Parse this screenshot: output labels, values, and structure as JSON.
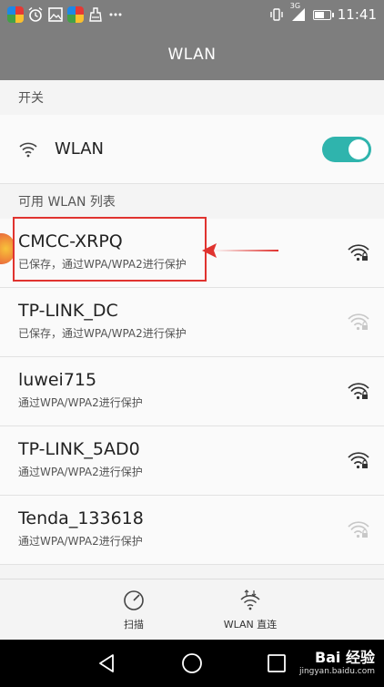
{
  "status_bar": {
    "time": "11:41",
    "network_type": "3G",
    "battery_percent": 70,
    "icons": [
      "browser-app-icon",
      "alarm-icon",
      "gallery-icon",
      "browser-app-icon",
      "cleaner-icon",
      "more-notifications-icon",
      "vibrate-icon",
      "signal-icon",
      "battery-icon"
    ]
  },
  "header": {
    "title": "WLAN"
  },
  "switch_section": {
    "header": "开关",
    "wlan_label": "WLAN",
    "wlan_enabled": true
  },
  "networks_section": {
    "header": "可用 WLAN 列表",
    "networks": [
      {
        "name": "CMCC-XRPQ",
        "status": "已保存，通过WPA/WPA2进行保护",
        "signal": "strong"
      },
      {
        "name": "TP-LINK_DC",
        "status": "已保存，通过WPA/WPA2进行保护",
        "signal": "weak"
      },
      {
        "name": "luwei715",
        "status": "通过WPA/WPA2进行保护",
        "signal": "strong"
      },
      {
        "name": "TP-LINK_5AD0",
        "status": "通过WPA/WPA2进行保护",
        "signal": "strong"
      },
      {
        "name": "Tenda_133618",
        "status": "通过WPA/WPA2进行保护",
        "signal": "weak"
      }
    ]
  },
  "bottom_bar": {
    "scan_label": "扫描",
    "direct_label": "WLAN 直连"
  },
  "watermark": {
    "main": "Bai 经验",
    "sub": "jingyan.baidu.com"
  },
  "colors": {
    "accent": "#2fb4ad",
    "header_bg": "#7e7e7e",
    "highlight": "#e0332f"
  }
}
